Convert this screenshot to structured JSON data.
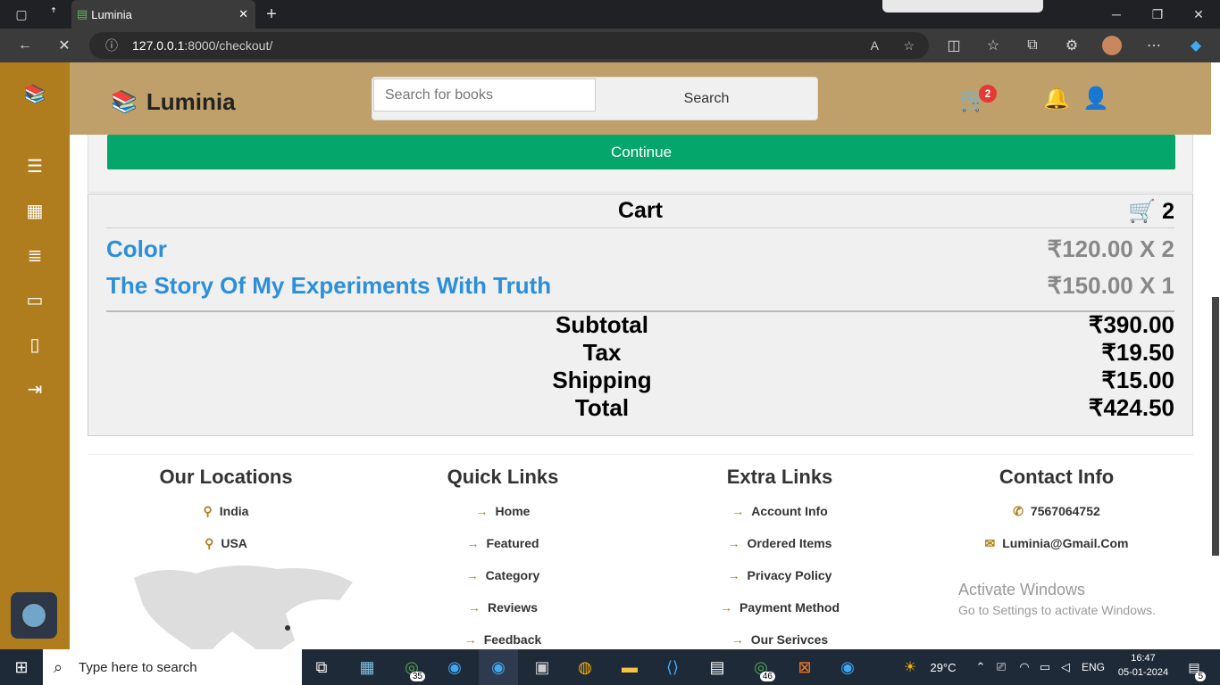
{
  "browser": {
    "tab_title": "Luminia",
    "url_host": "127.0.0.1",
    "url_rest": ":8000/checkout/"
  },
  "header": {
    "logo_text": "Luminia",
    "search_placeholder": "Search for books",
    "search_button": "Search",
    "cart_count": "2"
  },
  "checkout": {
    "continue_label": "Continue",
    "cart_title": "Cart",
    "cart_count": "2",
    "items": [
      {
        "name": "Color",
        "price": "₹120.00 X 2"
      },
      {
        "name": "The Story Of My Experiments With Truth",
        "price": "₹150.00 X 1"
      }
    ],
    "totals": [
      {
        "label": "Subtotal",
        "value": "₹390.00"
      },
      {
        "label": "Tax",
        "value": "₹19.50"
      },
      {
        "label": "Shipping",
        "value": "₹15.00"
      },
      {
        "label": "Total",
        "value": "₹424.50"
      }
    ]
  },
  "footer": {
    "locations": {
      "title": "Our Locations",
      "items": [
        "India",
        "USA"
      ]
    },
    "quick_links": {
      "title": "Quick Links",
      "items": [
        "Home",
        "Featured",
        "Category",
        "Reviews",
        "Feedback"
      ]
    },
    "extra_links": {
      "title": "Extra Links",
      "items": [
        "Account Info",
        "Ordered Items",
        "Privacy Policy",
        "Payment Method",
        "Our Serivces"
      ]
    },
    "contact": {
      "title": "Contact Info",
      "items": [
        "7567064752",
        "Luminia@Gmail.Com"
      ]
    }
  },
  "watermark": {
    "line1": "Activate Windows",
    "line2": "Go to Settings to activate Windows."
  },
  "taskbar": {
    "search_placeholder": "Type here to search",
    "whatsapp_badge": "35",
    "whatsapp2_badge": "46",
    "weather": "29°C",
    "language": "ENG",
    "time": "16:47",
    "date": "05-01-2024",
    "notif_count": "5"
  },
  "colors": {
    "sidebar": "#b07d1e",
    "header": "#bfa06a",
    "continue": "#05a66b",
    "link": "#2b8fd9"
  }
}
